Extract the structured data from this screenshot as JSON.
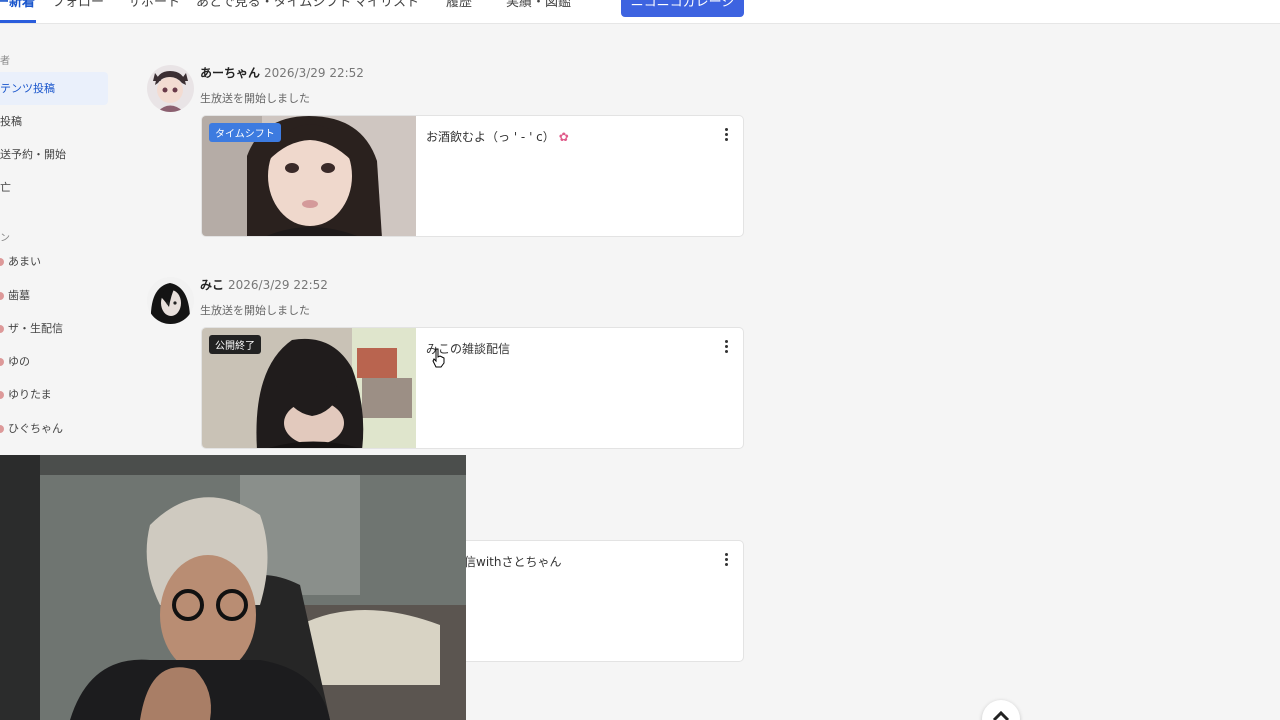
{
  "nav": {
    "items": [
      "新着",
      "フォロー",
      "サポート",
      "あとで見る・タイムシフト",
      "マイリスト",
      "履歴",
      "実績・図鑑"
    ],
    "garage_button": "ニコニコガレージ"
  },
  "sidebar": {
    "head1": "者",
    "items_top": [
      "テンツ投稿",
      "投稿",
      "送予約・開始",
      "亡"
    ],
    "head2": "ン",
    "items_users": [
      "あまい",
      "歯墓",
      "ザ・生配信",
      "ゆの",
      "ゆりたま",
      "ひぐちゃん"
    ]
  },
  "feed": [
    {
      "name": "あーちゃん",
      "date": "2026/3/29 22:52",
      "action": "生放送を開始しました",
      "badge": "タイムシフト",
      "badge_color": "#3d7be0",
      "title": "お酒飲むよ（っ ' - ' c）"
    },
    {
      "name": "みこ",
      "date": "2026/3/29 22:52",
      "action": "生放送を開始しました",
      "badge": "公開終了",
      "badge_color": "#222222",
      "title": "みこの雑談配信"
    },
    {
      "title": "信withさとちゃん"
    }
  ],
  "colors": {
    "accent": "#3d63e0",
    "active_bg": "#eaf0fb"
  }
}
